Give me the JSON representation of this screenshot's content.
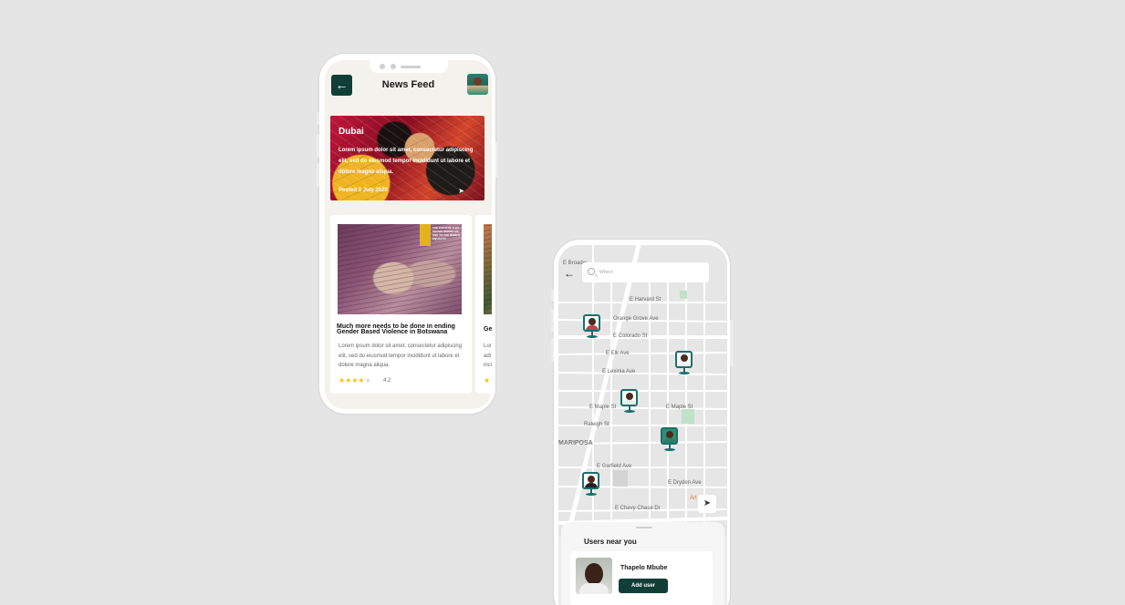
{
  "news_feed": {
    "title": "News Feed",
    "back_icon": "arrow-left-icon",
    "hero": {
      "title": "Dubai",
      "text": "Lorem ipsum dolor sit amet, consectetur adipiscing elit, sed do eiusmod tempor incididunt ut labore et dolore magna aliqua.",
      "meta": "Posted 3 July 2020"
    },
    "cards": [
      {
        "title": "Much more needs to be done in ending Gender Based Violence in Botswana",
        "text": "Lorem ipsum dolor sit amet, consectetur adipiscing elit, sed do eiusmod tempor incididunt ut labore et dolore magna aliqua.",
        "rating": 4.2,
        "rating_label": "4.2",
        "image_tag": "THE THEATRE THAT SHOWS WHERE AN END TO THE WORLD EQUALITY"
      },
      {
        "title": "Ge",
        "text": "Lor\nadi\ninci"
      }
    ]
  },
  "map_screen": {
    "search_placeholder": "Where",
    "back_icon": "arrow-left-icon",
    "street_labels": [
      "E Broadw",
      "E Colorado St",
      "Orange Grove Ave",
      "E Elk Ave",
      "E Lexinia Ave",
      "E Maple St",
      "E Maple St",
      "Raleigh St",
      "MARIPOSA",
      "E Garfield Ave",
      "E Chevy Chase Dr",
      "E Dryden Ave",
      "E Harvard St"
    ],
    "poi_label": "Art",
    "locate_icon": "navigation-arrow-icon",
    "sheet": {
      "title": "Users near you",
      "user_name": "Thapelo Mbube",
      "add_button": "Add user"
    }
  },
  "colors": {
    "primary": "#113e37",
    "pin": "#1c6e6a",
    "star": "#f1c40f",
    "background": "#e5e5e5"
  }
}
